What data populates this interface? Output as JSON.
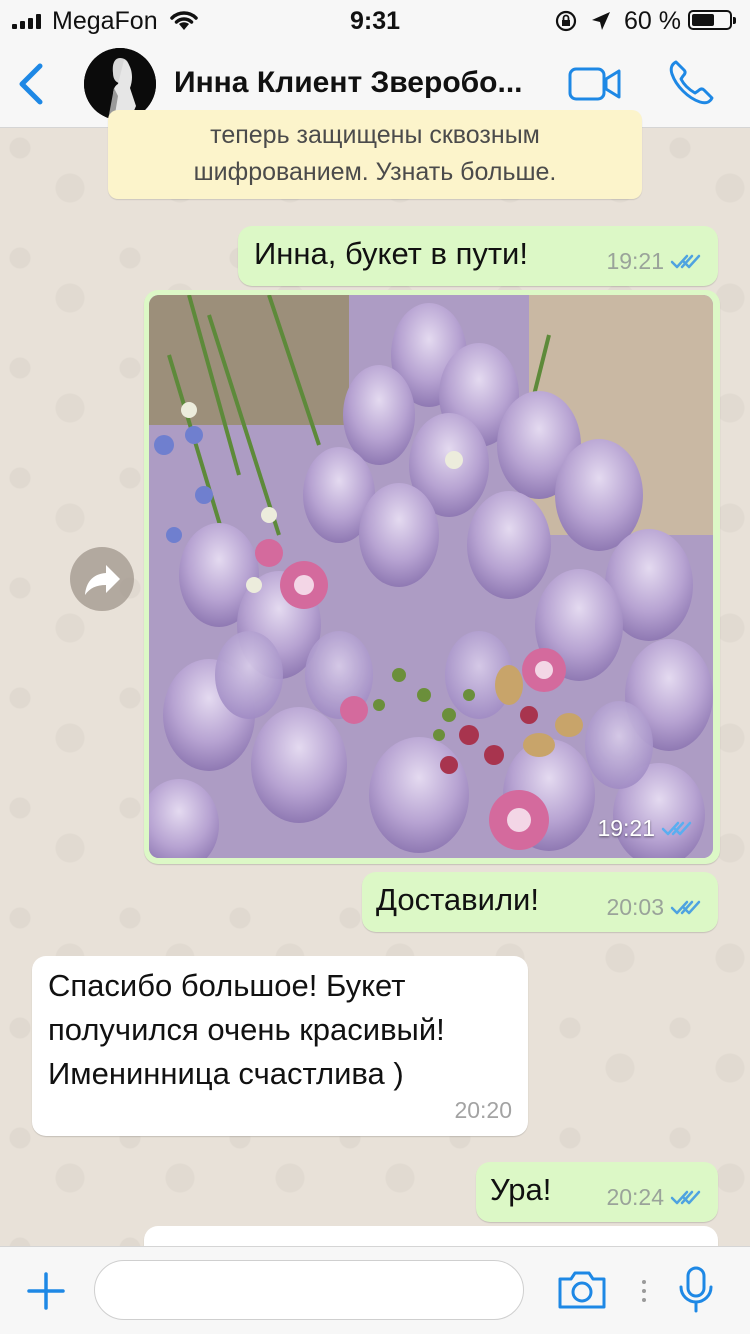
{
  "status_bar": {
    "carrier": "MegaFon",
    "time": "9:31",
    "battery_percent": "60 %",
    "battery_level": 0.6
  },
  "header": {
    "back_icon": "chevron-left-icon",
    "title": "Инна Клиент Зверобо...",
    "video_icon": "video-call-icon",
    "phone_icon": "phone-call-icon"
  },
  "encryption_notice": {
    "line1": "теперь защищены сквозным",
    "line2": "шифрованием. Узнать больше."
  },
  "messages": [
    {
      "direction": "out",
      "text": "Инна, букет в пути!",
      "time": "19:21",
      "status": "read"
    },
    {
      "direction": "out",
      "type": "image",
      "image_description": "photo",
      "time": "19:21",
      "status": "read"
    },
    {
      "direction": "out",
      "text": "Доставили!",
      "time": "20:03",
      "status": "read"
    },
    {
      "direction": "in",
      "lines": [
        "Спасибо большое! Букет",
        "получился очень красивый!",
        "Именинница счастлива )"
      ],
      "time": "20:20"
    },
    {
      "direction": "out",
      "text": "Ура!",
      "time": "20:24",
      "status": "read"
    }
  ],
  "input_bar": {
    "attach_icon": "plus-icon",
    "placeholder": "",
    "camera_icon": "camera-icon",
    "mic_icon": "microphone-icon"
  },
  "colors": {
    "accent": "#1e88e5",
    "outgoing_bubble": "#dcf8c6",
    "incoming_bubble": "#ffffff",
    "read_ticks": "#4fa3e0",
    "chat_background": "#e8e1d8"
  }
}
